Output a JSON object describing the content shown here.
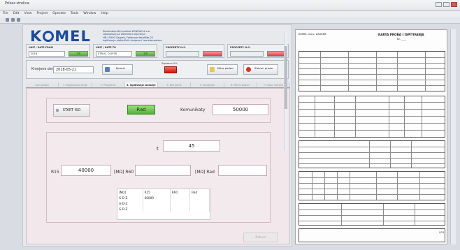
{
  "window": {
    "title": "Prikaz strelica",
    "buttons": [
      "minimize",
      "maximize",
      "close"
    ]
  },
  "menu": [
    "File",
    "Edit",
    "View",
    "Project",
    "Operate",
    "Tools",
    "Window",
    "Help"
  ],
  "company": {
    "logo": "KOMEL",
    "lines": [
      "Elektrotehnički institut KONČAR d.o.o.",
      "Laboratorij za električna mjerenja",
      "HR-10000 Zagreb, Fallerovo šetalište 22",
      "Ispitivanje električnih strojeva i transformatora"
    ]
  },
  "top_fields": [
    {
      "label": "UNIT / DATE FROM",
      "value": "2018",
      "button": "T/P"
    },
    {
      "label": "UNIT / DATE TO",
      "value": "STRUC. 0.0978",
      "button": "T/P"
    },
    {
      "label": "PROPERTY N.S.",
      "value": "",
      "button": ""
    },
    {
      "label": "PROPERTY N.O.",
      "value": "",
      "button": ""
    }
  ],
  "panel": {
    "date_label": "Krenjene datu",
    "date_value": "2018-05-21",
    "buttons": {
      "save": "Spremi",
      "list": "Mitra podaci",
      "close": "Zatvori prozor"
    },
    "save_indicator_label": "Zapisano O.K."
  },
  "tabs": [
    "Opći podaci",
    "1. Registracija stroja",
    "2. Podsjetnik",
    "3. Ispitivanje izolacije",
    "4. Bez pome",
    "5. Stavljanje",
    "6. Mjerni podaci",
    "7. Otpor namota"
  ],
  "active_tab_index": 3,
  "controls": {
    "start_label": "START ISO",
    "rad_label": "Rad",
    "komunikaty_label": "Komunikaty",
    "komunikaty_value": "50000",
    "t_label": "t",
    "t_value": "45",
    "r15_label": "R15",
    "r15_value": "40000",
    "mo_r60_label": "[MΩ] R60",
    "r60_value": "",
    "mo_rad_label": "[MΩ] Rad",
    "rad_value": "",
    "close_button": "Zatvori"
  },
  "table": {
    "headers": [
      "[MΩ]",
      "R15",
      "R60",
      "Rad"
    ],
    "rows": [
      [
        "G-D-Z",
        "40000",
        "",
        ""
      ],
      [
        "G-D-Z",
        "",
        "",
        ""
      ],
      [
        "G-D-Z",
        "",
        "",
        ""
      ]
    ]
  },
  "report": {
    "company": "KOMEL d.o.o. ZAGREB",
    "title": "KARTA PROBA I ISPITIVANJA",
    "number": "Br. ____",
    "page": "1/24"
  }
}
